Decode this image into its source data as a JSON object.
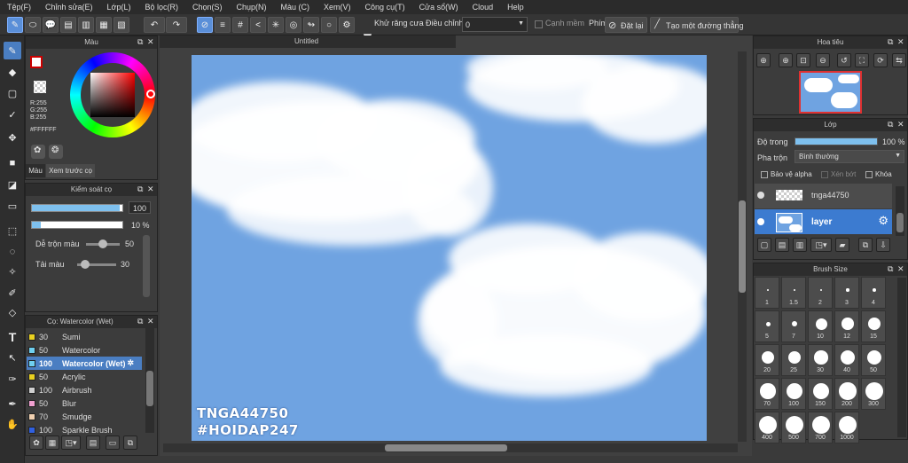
{
  "menu": [
    "Tệp(F)",
    "Chỉnh sửa(E)",
    "Lớp(L)",
    "Bộ lọc(R)",
    "Chọn(S)",
    "Chụp(N)",
    "Màu (C)",
    "Xem(V)",
    "Công cụ(T)",
    "Cửa sổ(W)",
    "Cloud",
    "Help"
  ],
  "toolbar": {
    "antialias_label": "Khử răng cưa",
    "adjust_label": "Điều chỉnh",
    "adjust_value": "0",
    "smooth_label": "Cạnh mềm",
    "key_label": "Phím",
    "reset_label": "Đặt lại",
    "line_label": "Tạo một đường thẳng"
  },
  "color_panel": {
    "title": "Màu",
    "r": "R:255",
    "g": "G:255",
    "b": "B:255",
    "hex": "#FFFFFF",
    "tab_color": "Màu",
    "tab_preview": "Xem trước cọ",
    "primary_color": "#ffffff",
    "secondary_color": "#5a8fd8"
  },
  "brush_control": {
    "title": "Kiểm soát cọ",
    "size_value": "100",
    "opacity_value": "10 %",
    "size_fraction": 0.97,
    "opacity_fraction": 0.1,
    "blend_label": "Dễ trộn màu",
    "blend_value": "50",
    "amount_label": "Tải màu",
    "amount_value": "30"
  },
  "brush_list": {
    "title": "Cọ: Watercolor (Wet)",
    "items": [
      {
        "size": "30",
        "name": "Sumi",
        "color": "#e8d020"
      },
      {
        "size": "50",
        "name": "Watercolor",
        "color": "#6fd0f0"
      },
      {
        "size": "100",
        "name": "Watercolor (Wet)",
        "color": "#6fd0f0"
      },
      {
        "size": "50",
        "name": "Acrylic",
        "color": "#e8d020"
      },
      {
        "size": "100",
        "name": "Airbrush",
        "color": "#d0d0d0"
      },
      {
        "size": "50",
        "name": "Blur",
        "color": "#f0a0d0"
      },
      {
        "size": "70",
        "name": "Smudge",
        "color": "#f0d0b0"
      },
      {
        "size": "100",
        "name": "Sparkle Brush",
        "color": "#3060e0"
      }
    ]
  },
  "canvas": {
    "tab_title": "Untitled",
    "signature_line1": "TNGA44750",
    "signature_line2": "#HOIDAP247",
    "sky_color": "#6fa3e1"
  },
  "navigator": {
    "title": "Hoa tiêu"
  },
  "layers": {
    "title": "Lớp",
    "opacity_label": "Độ trong",
    "opacity_value": "100 %",
    "blend_label": "Pha trộn",
    "blend_value": "Bình thường",
    "protect_alpha": "Bảo vệ alpha",
    "clipping": "Xén bớt",
    "lock": "Khóa",
    "items": [
      {
        "name": "tnga44750"
      },
      {
        "name": "layer"
      }
    ]
  },
  "brush_size": {
    "title": "Brush Size",
    "sizes": [
      "1",
      "1.5",
      "2",
      "3",
      "4",
      "5",
      "7",
      "10",
      "12",
      "15",
      "20",
      "25",
      "30",
      "40",
      "50",
      "70",
      "100",
      "150",
      "200",
      "300",
      "400",
      "500",
      "700",
      "1000"
    ]
  }
}
